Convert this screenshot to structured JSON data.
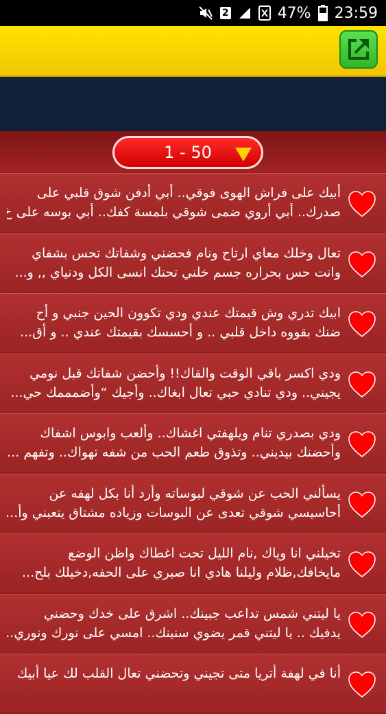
{
  "status_bar": {
    "battery": "47%",
    "time": "23:59",
    "sim_badge": "2",
    "icons": [
      "mute-icon",
      "sim-2-icon",
      "signal-icon",
      "no-sim-icon",
      "battery-icon"
    ]
  },
  "pager": {
    "range": "1 - 50"
  },
  "colors": {
    "toolbar": "#ffe300",
    "navy": "#0f2038",
    "list_bg": "#a52828",
    "pager": "#ff1a1a",
    "accent": "#ffd400"
  },
  "messages": [
    {
      "line1": "أبيك على فراش الهوى فوقي.. أبي أدفن شوق قلبي على",
      "line2": "صدرك.. أبي أروي ضمى شوقي بلمسة كفك.. أبي بوسه على خ..."
    },
    {
      "line1": "تعال وخلك معاي ارتاح ونام فحضني وشفاتك تحس بشفاي",
      "line2": "وانت حس بحراره جسم خلني تحتك انسى الكل ودنياي ,, و..."
    },
    {
      "line1": "ابيك تدري وش قيمتك عندي ودي تكوون الحين جنبي و أح",
      "line2": "ضنك بقووه داخل قلبي .. و أحسسك بقيمتك عندي .. و أق..."
    },
    {
      "line1": "ودي اكسر باقي الوقت والقاك!! وأحضن شفاتك قبل نومي",
      "line2": "يجيني.. ودي تنادي حبي تعال ابغاك.. وأجيك “وأضمممك حي..."
    },
    {
      "line1": "ودي بصدري تنام ويلهفتي اغشاك.. وألعب وابوس اشفاك",
      "line2": "وأحضنك بيديني.. وتذوق طعم الحب من شفه تهواك.. وتفهم ..."
    },
    {
      "line1": "يسألني الحب عن شوقي لبوساته وأرد أنا بكل لهفه عن",
      "line2": "أحاسيسي شوقي تعدى عن البوسات وزياده مشتاق يتعبني وأ..."
    },
    {
      "line1": "تخيلني انا وياك ,نام الليل تحت اغطاك واظن الوضع",
      "line2": "مايخافك,ظلام وليلنا هادي انا صبري على الحفه,دخيلك بلح..."
    },
    {
      "line1": "يا ليتني شمس تداعب جبينك.. اشرق على خدك وحضني",
      "line2": "يدفيك .. يا ليتني قمر يضوي سنينك.. امسي على نورك ونوري..."
    },
    {
      "line1": "أنا في لهفة أتريا متى تجيني وتحضني تعال القلب لك عيا أبيك",
      "line2": ""
    }
  ]
}
